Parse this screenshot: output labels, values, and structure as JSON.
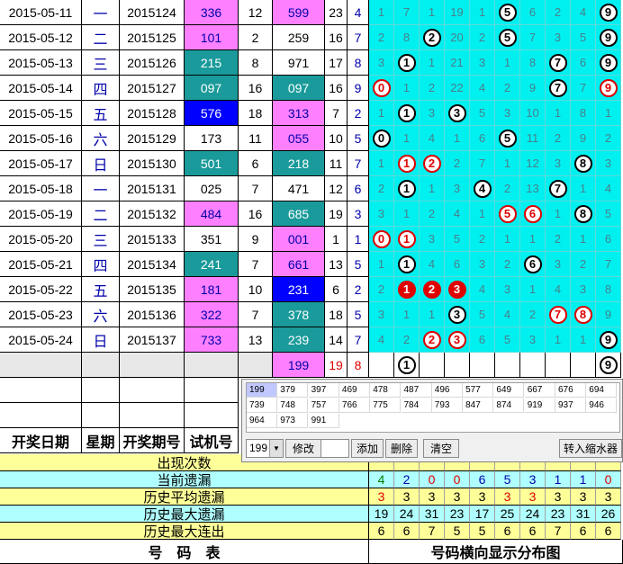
{
  "rows": [
    {
      "date": "2015-05-11",
      "weekday": "一",
      "issue": "2015124",
      "trial": "336",
      "trial_sum": "12",
      "draw": "599",
      "draw_sum": "23",
      "span": "4",
      "dist": [
        "1",
        "7",
        "1",
        "19",
        "1",
        "5",
        "6",
        "2",
        "4",
        "9"
      ]
    },
    {
      "date": "2015-05-12",
      "weekday": "二",
      "issue": "2015125",
      "trial": "101",
      "trial_sum": "2",
      "draw": "259",
      "draw_sum": "16",
      "span": "7",
      "dist": [
        "2",
        "8",
        "2",
        "20",
        "2",
        "5",
        "7",
        "3",
        "5",
        "9"
      ]
    },
    {
      "date": "2015-05-13",
      "weekday": "三",
      "issue": "2015126",
      "trial": "215",
      "trial_sum": "8",
      "draw": "971",
      "draw_sum": "17",
      "span": "8",
      "dist": [
        "3",
        "1",
        "1",
        "21",
        "3",
        "1",
        "8",
        "7",
        "6",
        "9"
      ]
    },
    {
      "date": "2015-05-14",
      "weekday": "四",
      "issue": "2015127",
      "trial": "097",
      "trial_sum": "16",
      "draw": "097",
      "draw_sum": "16",
      "span": "9",
      "dist": [
        "0",
        "1",
        "2",
        "22",
        "4",
        "2",
        "9",
        "7",
        "7",
        "9"
      ]
    },
    {
      "date": "2015-05-15",
      "weekday": "五",
      "issue": "2015128",
      "trial": "576",
      "trial_sum": "18",
      "draw": "313",
      "draw_sum": "7",
      "span": "2",
      "dist": [
        "1",
        "1",
        "3",
        "3",
        "5",
        "3",
        "10",
        "1",
        "8",
        "1"
      ]
    },
    {
      "date": "2015-05-16",
      "weekday": "六",
      "issue": "2015129",
      "trial": "173",
      "trial_sum": "11",
      "draw": "055",
      "draw_sum": "10",
      "span": "5",
      "dist": [
        "0",
        "1",
        "4",
        "1",
        "6",
        "5",
        "11",
        "2",
        "9",
        "2"
      ]
    },
    {
      "date": "2015-05-17",
      "weekday": "日",
      "issue": "2015130",
      "trial": "501",
      "trial_sum": "6",
      "draw": "218",
      "draw_sum": "11",
      "span": "7",
      "dist": [
        "1",
        "1",
        "2",
        "2",
        "7",
        "1",
        "12",
        "3",
        "8",
        "3"
      ]
    },
    {
      "date": "2015-05-18",
      "weekday": "一",
      "issue": "2015131",
      "trial": "025",
      "trial_sum": "7",
      "draw": "471",
      "draw_sum": "12",
      "span": "6",
      "dist": [
        "2",
        "1",
        "1",
        "3",
        "4",
        "2",
        "13",
        "7",
        "1",
        "4"
      ]
    },
    {
      "date": "2015-05-19",
      "weekday": "二",
      "issue": "2015132",
      "trial": "484",
      "trial_sum": "16",
      "draw": "685",
      "draw_sum": "19",
      "span": "3",
      "dist": [
        "3",
        "1",
        "2",
        "4",
        "1",
        "5",
        "6",
        "1",
        "8",
        "5"
      ]
    },
    {
      "date": "2015-05-20",
      "weekday": "三",
      "issue": "2015133",
      "trial": "351",
      "trial_sum": "9",
      "draw": "001",
      "draw_sum": "1",
      "span": "1",
      "dist": [
        "0",
        "1",
        "3",
        "5",
        "2",
        "1",
        "1",
        "2",
        "1",
        "6"
      ]
    },
    {
      "date": "2015-05-21",
      "weekday": "四",
      "issue": "2015134",
      "trial": "241",
      "trial_sum": "7",
      "draw": "661",
      "draw_sum": "13",
      "span": "5",
      "dist": [
        "1",
        "1",
        "4",
        "6",
        "3",
        "2",
        "6",
        "3",
        "2",
        "7"
      ]
    },
    {
      "date": "2015-05-22",
      "weekday": "五",
      "issue": "2015135",
      "trial": "181",
      "trial_sum": "10",
      "draw": "231",
      "draw_sum": "6",
      "span": "2",
      "dist": [
        "2",
        "1",
        "2",
        "3",
        "4",
        "3",
        "1",
        "4",
        "3",
        "8"
      ]
    },
    {
      "date": "2015-05-23",
      "weekday": "六",
      "issue": "2015136",
      "trial": "322",
      "trial_sum": "7",
      "draw": "378",
      "draw_sum": "18",
      "span": "5",
      "dist": [
        "3",
        "1",
        "1",
        "3",
        "5",
        "4",
        "2",
        "7",
        "8",
        "9"
      ]
    },
    {
      "date": "2015-05-24",
      "weekday": "日",
      "issue": "2015137",
      "trial": "733",
      "trial_sum": "13",
      "draw": "239",
      "draw_sum": "14",
      "span": "7",
      "dist": [
        "4",
        "2",
        "2",
        "3",
        "6",
        "5",
        "3",
        "1",
        "1",
        "9"
      ]
    }
  ],
  "trial_bg": [
    "#ff80ff",
    "#ff80ff",
    "#1a9a9a",
    "#1a9a9a",
    "#0000ff",
    "#ffffff",
    "#1a9a9a",
    "#ffffff",
    "#ff80ff",
    "#ffffff",
    "#1a9a9a",
    "#ff80ff",
    "#ff80ff",
    "#ff80ff"
  ],
  "draw_bg": [
    "#ff80ff",
    "#ffffff",
    "#ffffff",
    "#1a9a9a",
    "#ff80ff",
    "#ff80ff",
    "#1a9a9a",
    "#ffffff",
    "#1a9a9a",
    "#ff80ff",
    "#ff80ff",
    "#0000ff",
    "#1a9a9a",
    "#1a9a9a"
  ],
  "balls": [
    [
      [
        5,
        "b"
      ],
      [
        9,
        "b"
      ]
    ],
    [
      [
        2,
        "b"
      ],
      [
        5,
        "b"
      ],
      [
        9,
        "b"
      ]
    ],
    [
      [
        1,
        "b"
      ],
      [
        7,
        "b"
      ],
      [
        9,
        "b"
      ]
    ],
    [
      [
        0,
        "r"
      ],
      [
        7,
        "b"
      ],
      [
        9,
        "r"
      ]
    ],
    [
      [
        1,
        "b"
      ],
      [
        3,
        "b"
      ]
    ],
    [
      [
        0,
        "b"
      ],
      [
        5,
        "b"
      ]
    ],
    [
      [
        1,
        "r"
      ],
      [
        2,
        "r"
      ],
      [
        8,
        "b"
      ]
    ],
    [
      [
        1,
        "b"
      ],
      [
        4,
        "b"
      ],
      [
        7,
        "b"
      ]
    ],
    [
      [
        5,
        "r"
      ],
      [
        6,
        "r"
      ],
      [
        8,
        "b"
      ]
    ],
    [
      [
        0,
        "r"
      ],
      [
        1,
        "r"
      ]
    ],
    [
      [
        1,
        "b"
      ],
      [
        6,
        "b"
      ]
    ],
    [
      [
        1,
        "f"
      ],
      [
        2,
        "f"
      ],
      [
        3,
        "f"
      ]
    ],
    [
      [
        3,
        "b"
      ],
      [
        7,
        "r"
      ],
      [
        8,
        "r"
      ]
    ],
    [
      [
        2,
        "r"
      ],
      [
        3,
        "r"
      ],
      [
        9,
        "b"
      ]
    ]
  ],
  "next": {
    "draw": "199",
    "draw_sum": "19",
    "span": "8",
    "balls": [
      "1",
      "9"
    ]
  },
  "headers": {
    "date": "开奖日期",
    "weekday": "星期",
    "issue": "开奖期号",
    "trial": "试机号"
  },
  "stats": [
    {
      "label": "出现次数",
      "values": [
        "",
        "",
        "",
        "",
        "",
        "",
        "",
        "",
        "",
        ""
      ]
    },
    {
      "label": "当前遗漏",
      "values": [
        "4",
        "2",
        "0",
        "0",
        "6",
        "5",
        "3",
        "1",
        "1",
        "0"
      ]
    },
    {
      "label": "历史平均遗漏",
      "values": [
        "3",
        "3",
        "3",
        "3",
        "3",
        "3",
        "3",
        "3",
        "3",
        "3"
      ]
    },
    {
      "label": "历史最大遗漏",
      "values": [
        "19",
        "24",
        "31",
        "23",
        "17",
        "25",
        "24",
        "23",
        "31",
        "26"
      ]
    },
    {
      "label": "历史最大连出",
      "values": [
        "6",
        "6",
        "7",
        "5",
        "5",
        "6",
        "6",
        "7",
        "6",
        "6"
      ]
    }
  ],
  "footer": {
    "left": "号　码　表",
    "right": "号码横向显示分布图"
  },
  "popup": {
    "items": [
      "199",
      "379",
      "397",
      "469",
      "478",
      "487",
      "496",
      "577",
      "649",
      "667",
      "676",
      "694",
      "739",
      "748",
      "757",
      "766",
      "775",
      "784",
      "793",
      "847",
      "874",
      "919",
      "937",
      "946",
      "964",
      "973",
      "991"
    ],
    "select_value": "199",
    "modify": "修改",
    "add": "添加",
    "delete": "删除",
    "clear": "清空",
    "shrink": "转入缩水器"
  },
  "colors": {
    "dist_bg": "#00f0f0",
    "stat_yellow": "#ffff99",
    "stat_cyan": "#b0ffff",
    "green": "#00a000",
    "red": "#e00000"
  }
}
